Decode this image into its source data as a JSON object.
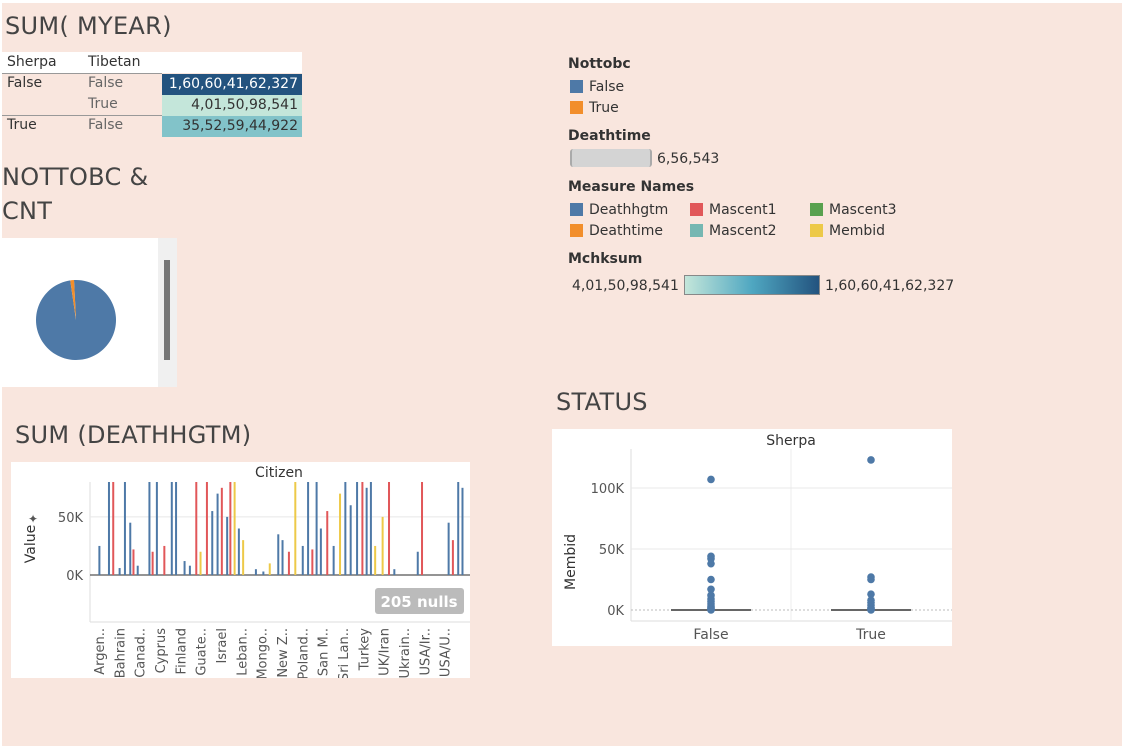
{
  "colors": {
    "deathhgtm": "#4e79a7",
    "deathtime": "#f28e2b",
    "mascent1": "#e15759",
    "mascent2": "#76b7b2",
    "mascent3": "#59a14f",
    "membid": "#edc948",
    "bg": "#f9e6de",
    "dark_cell": "#23537f",
    "light_cell": "#c4e6da",
    "mid_cell": "#82c3c9"
  },
  "sum_myear": {
    "title": "SUM( MYEAR)",
    "headers": [
      "Sherpa",
      "Tibetan"
    ],
    "rows": [
      {
        "sherpa": "False",
        "tibetan": "False",
        "value": "1,60,60,41,62,327"
      },
      {
        "sherpa": "",
        "tibetan": "True",
        "value": "4,01,50,98,541"
      },
      {
        "sherpa": "True",
        "tibetan": "False",
        "value": "35,52,59,44,922"
      }
    ]
  },
  "pie": {
    "title_line1": "NOTTOBC &",
    "title_line2": "CNT",
    "slices": [
      {
        "label": "False",
        "share": 0.985,
        "color": "#4e79a7"
      },
      {
        "label": "True",
        "share": 0.015,
        "color": "#f28e2b"
      }
    ]
  },
  "legends": {
    "nottobc_title": "Nottobc",
    "nottobc_items": [
      {
        "label": "False",
        "color": "#4e79a7"
      },
      {
        "label": "True",
        "color": "#f28e2b"
      }
    ],
    "deathtime_title": "Deathtime",
    "deathtime_value": "6,56,543",
    "measure_title": "Measure Names",
    "measure_items": [
      {
        "label": "Deathhgtm",
        "color": "#4e79a7"
      },
      {
        "label": "Mascent1",
        "color": "#e15759"
      },
      {
        "label": "Mascent3",
        "color": "#59a14f"
      },
      {
        "label": "Deathtime",
        "color": "#f28e2b"
      },
      {
        "label": "Mascent2",
        "color": "#76b7b2"
      },
      {
        "label": "Membid",
        "color": "#edc948"
      }
    ],
    "mchksum_title": "Mchksum",
    "mchksum_min": "4,01,50,98,541",
    "mchksum_max": "1,60,60,41,62,327"
  },
  "deathhgtm": {
    "title": "SUM (DEATHHGTM)",
    "header": "Citizen",
    "ylabel": "Value",
    "nulls_badge": "205 nulls",
    "categories": [
      "Argen..",
      "Bahrain",
      "Canad..",
      "Cyprus",
      "Finland",
      "Guate..",
      "Israel",
      "Leban..",
      "Mongo..",
      "New Z..",
      "Poland..",
      "San M..",
      "Sri Lan..",
      "Turkey",
      "UK/Iran",
      "Ukrain..",
      "USA/Ir..",
      "USA/U.."
    ]
  },
  "status": {
    "title": "STATUS",
    "header": "Sherpa",
    "ylabel": "Membid",
    "x_categories": [
      "False",
      "True"
    ]
  },
  "chart_data": [
    {
      "type": "bar",
      "title": "SUM (DEATHHGTM)",
      "xlabel": "Citizen",
      "ylabel": "Value",
      "ylim": [
        0,
        80000
      ],
      "y_ticks": [
        "0K",
        "50K"
      ],
      "x_tick_labels": [
        "Argen..",
        "Bahrain",
        "Canad..",
        "Cyprus",
        "Finland",
        "Guate..",
        "Israel",
        "Leban..",
        "Mongo..",
        "New Z..",
        "Poland..",
        "San M..",
        "Sri Lan..",
        "Turkey",
        "UK/Iran",
        "Ukrain..",
        "USA/Ir..",
        "USA/U.."
      ],
      "series_colors": {
        "Deathhgtm": "#4e79a7",
        "Mascent1": "#e15759",
        "Membid": "#edc948"
      },
      "bars": [
        {
          "x": 0.6,
          "h": 25000,
          "c": "#4e79a7"
        },
        {
          "x": 1.5,
          "h": 80000,
          "c": "#4e79a7"
        },
        {
          "x": 1.9,
          "h": 80000,
          "c": "#e15759"
        },
        {
          "x": 2.5,
          "h": 6000,
          "c": "#4e79a7"
        },
        {
          "x": 3.0,
          "h": 80000,
          "c": "#4e79a7"
        },
        {
          "x": 3.5,
          "h": 45000,
          "c": "#4e79a7"
        },
        {
          "x": 3.8,
          "h": 22000,
          "c": "#e15759"
        },
        {
          "x": 4.2,
          "h": 8000,
          "c": "#4e79a7"
        },
        {
          "x": 5.3,
          "h": 80000,
          "c": "#4e79a7"
        },
        {
          "x": 5.6,
          "h": 20000,
          "c": "#e15759"
        },
        {
          "x": 6.0,
          "h": 80000,
          "c": "#4e79a7"
        },
        {
          "x": 6.7,
          "h": 25000,
          "c": "#e15759"
        },
        {
          "x": 7.4,
          "h": 80000,
          "c": "#4e79a7"
        },
        {
          "x": 7.8,
          "h": 80000,
          "c": "#4e79a7"
        },
        {
          "x": 8.6,
          "h": 12000,
          "c": "#4e79a7"
        },
        {
          "x": 9.1,
          "h": 8000,
          "c": "#4e79a7"
        },
        {
          "x": 9.7,
          "h": 80000,
          "c": "#e15759"
        },
        {
          "x": 10.1,
          "h": 20000,
          "c": "#edc948"
        },
        {
          "x": 10.7,
          "h": 80000,
          "c": "#e15759"
        },
        {
          "x": 11.2,
          "h": 55000,
          "c": "#4e79a7"
        },
        {
          "x": 11.7,
          "h": 70000,
          "c": "#4e79a7"
        },
        {
          "x": 12.1,
          "h": 75000,
          "c": "#e15759"
        },
        {
          "x": 12.6,
          "h": 50000,
          "c": "#4e79a7"
        },
        {
          "x": 12.9,
          "h": 80000,
          "c": "#e15759"
        },
        {
          "x": 13.3,
          "h": 80000,
          "c": "#edc948"
        },
        {
          "x": 13.7,
          "h": 40000,
          "c": "#4e79a7"
        },
        {
          "x": 14.1,
          "h": 30000,
          "c": "#edc948"
        },
        {
          "x": 15.3,
          "h": 5000,
          "c": "#4e79a7"
        },
        {
          "x": 16.0,
          "h": 3000,
          "c": "#4e79a7"
        },
        {
          "x": 16.6,
          "h": 10000,
          "c": "#edc948"
        },
        {
          "x": 17.4,
          "h": 35000,
          "c": "#4e79a7"
        },
        {
          "x": 17.8,
          "h": 30000,
          "c": "#4e79a7"
        },
        {
          "x": 18.4,
          "h": 20000,
          "c": "#e15759"
        },
        {
          "x": 19.0,
          "h": 80000,
          "c": "#edc948"
        },
        {
          "x": 19.7,
          "h": 25000,
          "c": "#4e79a7"
        },
        {
          "x": 20.2,
          "h": 80000,
          "c": "#4e79a7"
        },
        {
          "x": 20.6,
          "h": 22000,
          "c": "#e15759"
        },
        {
          "x": 21.0,
          "h": 80000,
          "c": "#4e79a7"
        },
        {
          "x": 21.4,
          "h": 40000,
          "c": "#4e79a7"
        },
        {
          "x": 22.0,
          "h": 55000,
          "c": "#e15759"
        },
        {
          "x": 22.6,
          "h": 25000,
          "c": "#4e79a7"
        },
        {
          "x": 23.2,
          "h": 70000,
          "c": "#edc948"
        },
        {
          "x": 23.7,
          "h": 80000,
          "c": "#4e79a7"
        },
        {
          "x": 24.2,
          "h": 60000,
          "c": "#4e79a7"
        },
        {
          "x": 24.8,
          "h": 80000,
          "c": "#4e79a7"
        },
        {
          "x": 25.3,
          "h": 80000,
          "c": "#e15759"
        },
        {
          "x": 25.7,
          "h": 75000,
          "c": "#4e79a7"
        },
        {
          "x": 26.1,
          "h": 80000,
          "c": "#4e79a7"
        },
        {
          "x": 26.5,
          "h": 25000,
          "c": "#edc948"
        },
        {
          "x": 27.2,
          "h": 50000,
          "c": "#edc948"
        },
        {
          "x": 27.8,
          "h": 80000,
          "c": "#e15759"
        },
        {
          "x": 28.3,
          "h": 5000,
          "c": "#4e79a7"
        },
        {
          "x": 30.5,
          "h": 20000,
          "c": "#4e79a7"
        },
        {
          "x": 30.9,
          "h": 80000,
          "c": "#e15759"
        },
        {
          "x": 33.4,
          "h": 45000,
          "c": "#4e79a7"
        },
        {
          "x": 33.8,
          "h": 30000,
          "c": "#e15759"
        },
        {
          "x": 34.3,
          "h": 80000,
          "c": "#4e79a7"
        },
        {
          "x": 34.7,
          "h": 75000,
          "c": "#4e79a7"
        }
      ]
    },
    {
      "type": "scatter",
      "title": "STATUS",
      "xlabel": "Sherpa",
      "ylabel": "Membid",
      "categories": [
        "False",
        "True"
      ],
      "ylim": [
        -8000,
        130000
      ],
      "y_ticks": [
        "0K",
        "50K",
        "100K"
      ],
      "series": [
        {
          "name": "False",
          "values": [
            107000,
            44000,
            42000,
            38000,
            25000,
            17000,
            12000,
            9000,
            7000,
            5000,
            3000,
            2000,
            1000,
            500,
            0
          ]
        },
        {
          "name": "True",
          "values": [
            123000,
            27000,
            25000,
            13000,
            8000,
            6000,
            4000,
            2000,
            1000,
            500,
            0
          ]
        }
      ]
    }
  ]
}
